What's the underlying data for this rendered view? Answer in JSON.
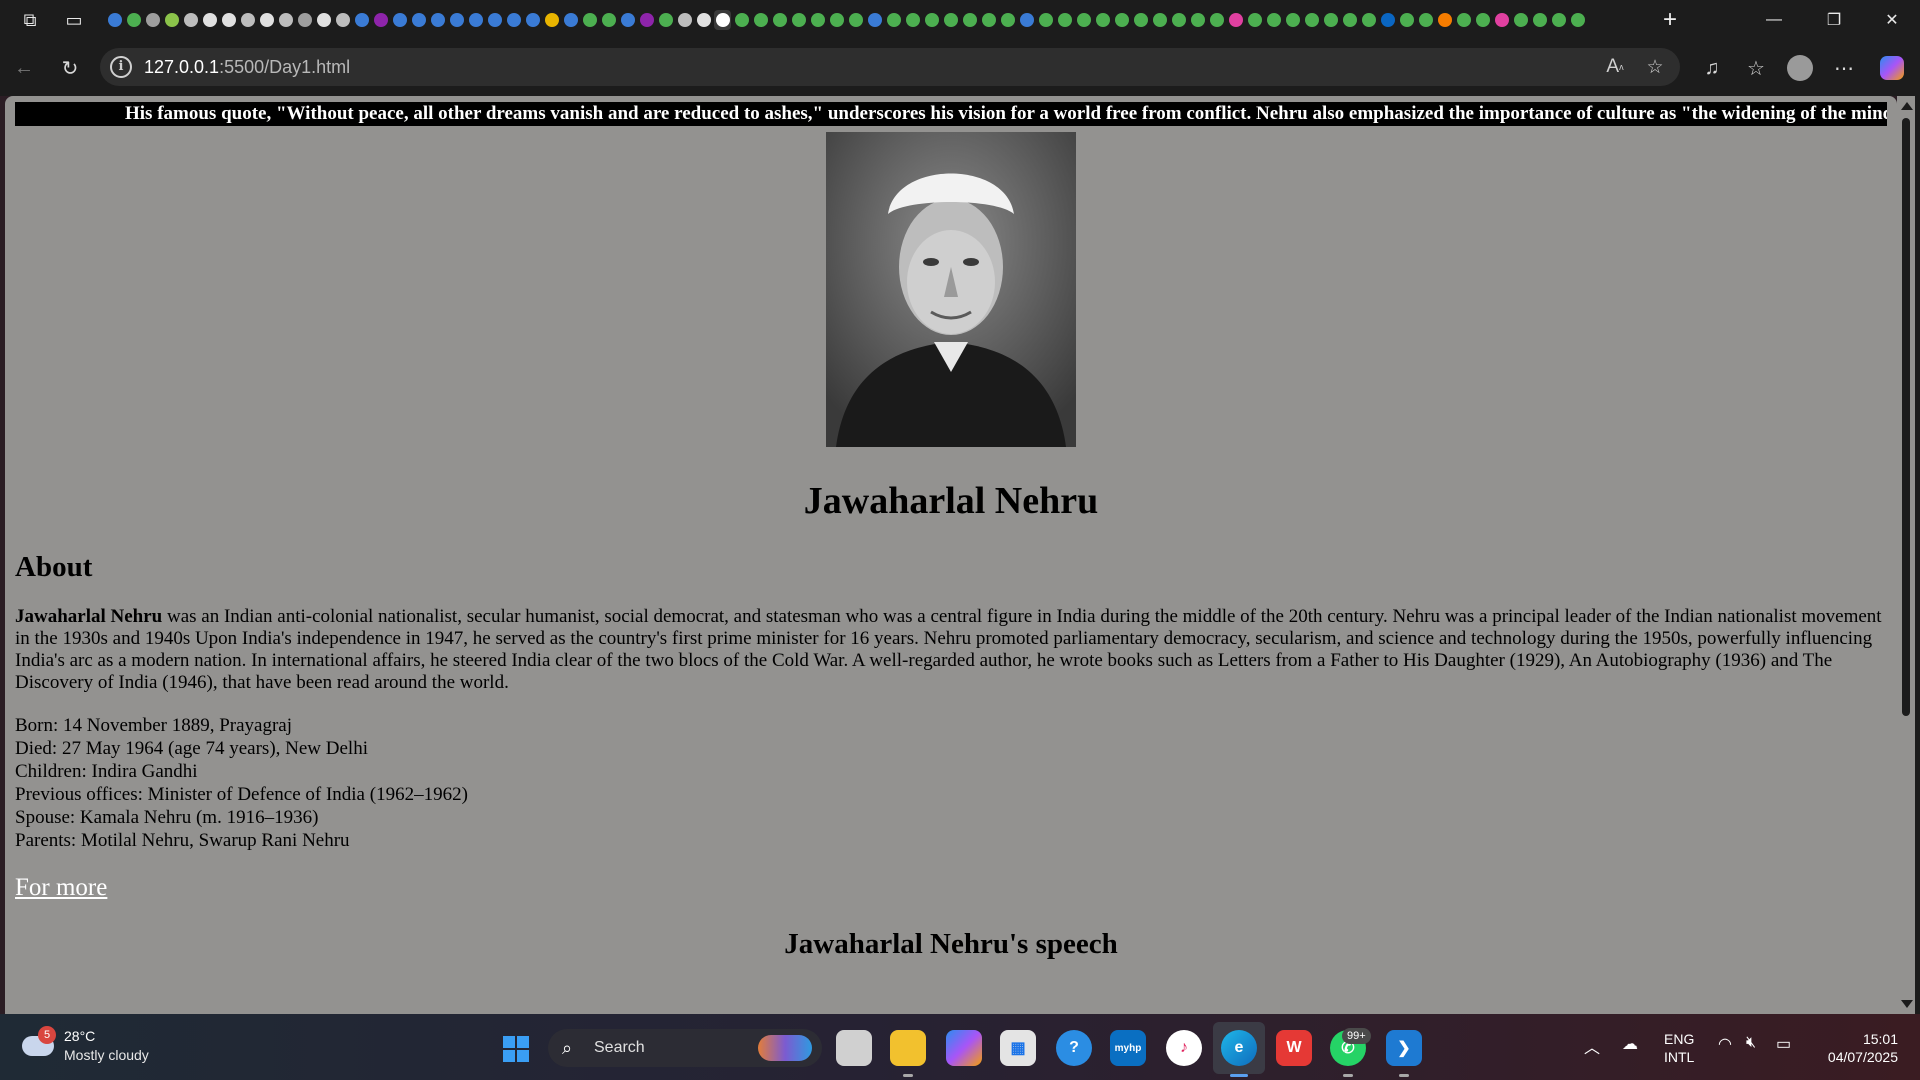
{
  "browser": {
    "url_host": "127.0.0.1",
    "url_path": ":5500/Day1.html",
    "tab_colors": [
      "#3a7bd5",
      "#4caf50",
      "#9e9e9e",
      "#8bc34a",
      "#bdbdbd",
      "#e0e0e0",
      "#e0e0e0",
      "#bdbdbd",
      "#e0e0e0",
      "#bdbdbd",
      "#9e9e9e",
      "#e0e0e0",
      "#bdbdbd",
      "#3a7bd5",
      "#8e24aa",
      "#3a7bd5",
      "#3a7bd5",
      "#3a7bd5",
      "#3a7bd5",
      "#3a7bd5",
      "#3a7bd5",
      "#3a7bd5",
      "#3a7bd5",
      "#e8b400",
      "#3a7bd5",
      "#4caf50",
      "#4caf50",
      "#3a7bd5",
      "#8e24aa",
      "#4caf50",
      "#bdbdbd",
      "#e0e0e0",
      "#ffffff",
      "#4caf50",
      "#4caf50",
      "#4caf50",
      "#4caf50",
      "#4caf50",
      "#4caf50",
      "#4caf50",
      "#3a7bd5",
      "#4caf50",
      "#4caf50",
      "#4caf50",
      "#4caf50",
      "#4caf50",
      "#4caf50",
      "#4caf50",
      "#3a7bd5",
      "#4caf50",
      "#4caf50",
      "#4caf50",
      "#4caf50",
      "#4caf50",
      "#4caf50",
      "#4caf50",
      "#4caf50",
      "#4caf50",
      "#4caf50",
      "#e040a0",
      "#4caf50",
      "#4caf50",
      "#4caf50",
      "#4caf50",
      "#4caf50",
      "#4caf50",
      "#4caf50",
      "#0a66c2",
      "#4caf50",
      "#4caf50",
      "#f57c00",
      "#4caf50",
      "#4caf50",
      "#e040a0",
      "#4caf50",
      "#4caf50",
      "#4caf50",
      "#4caf50"
    ]
  },
  "page": {
    "marquee": "His famous quote, \"Without peace, all other dreams vanish and are reduced to ashes,\" underscores his vision for a world free from conflict. Nehru also emphasized the importance of culture as \"the widening of the mind and",
    "title": "Jawaharlal Nehru",
    "about_heading": "About",
    "bio_name": "Jawaharlal Nehru",
    "bio_text": " was an Indian anti-colonial nationalist, secular humanist, social democrat, and statesman who was a central figure in India during the middle of the 20th century. Nehru was a principal leader of the Indian nationalist movement in the 1930s and 1940s Upon India's independence in 1947, he served as the country's first prime minister for 16 years. Nehru promoted parliamentary democracy, secularism, and science and technology during the 1950s, powerfully influencing India's arc as a modern nation. In international affairs, he steered India clear of the two blocs of the Cold War. A well-regarded author, he wrote books such as Letters from a Father to His Daughter (1929), An Autobiography (1936) and The Discovery of India (1946), that have been read around the world.",
    "facts": [
      "Born: 14 November 1889, Prayagraj",
      "Died: 27 May 1964 (age 74 years), New Delhi",
      "Children: Indira Gandhi",
      "Previous offices: Minister of Defence of India (1962–1962)",
      "Spouse: Kamala Nehru (m. 1916–1936)",
      "Parents: Motilal Nehru, Swarup Rani Nehru"
    ],
    "more_link": "For more",
    "speech_heading": "Jawaharlal Nehru's speech"
  },
  "taskbar": {
    "weather_badge": "5",
    "temperature": "28°C",
    "condition": "Mostly cloudy",
    "search_label": "Search",
    "whatsapp_badge": "99+",
    "lang_line1": "ENG",
    "lang_line2": "INTL",
    "time": "15:01",
    "date": "04/07/2025"
  }
}
